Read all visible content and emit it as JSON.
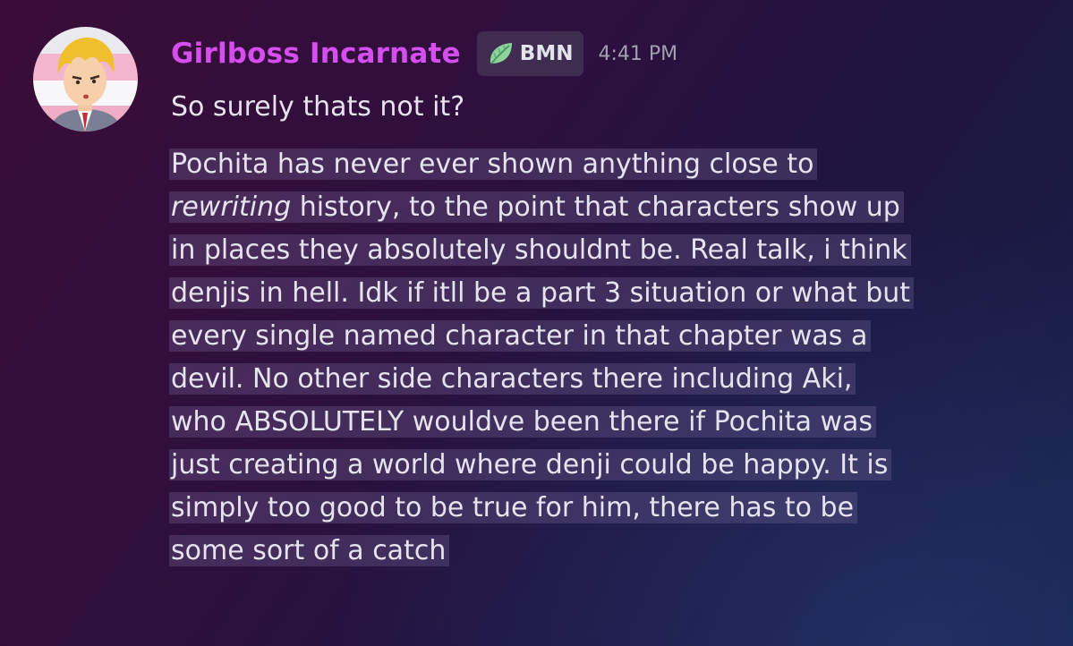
{
  "message": {
    "author": "Girlboss Incarnate",
    "role_tag": {
      "icon": "leaf-icon",
      "label": "BMN"
    },
    "timestamp": "4:41 PM",
    "first_line": "So surely thats not it?",
    "quote": {
      "l1": "Pochita has never ever shown anything close to",
      "l2_em": "rewriting",
      "l2_rest": " history, to the point that characters show up",
      "l3": "in places they absolutely shouldnt be. Real talk, i think",
      "l4": "denjis in hell. Idk if itll be a part 3 situation or what but",
      "l5": "every single named character in that chapter was a",
      "l6": "devil. No other side characters there including Aki,",
      "l7": "who ABSOLUTELY wouldve been there if Pochita was",
      "l8": "just creating a world where denji could be happy. It is",
      "l9": "simply too good to be true for him, there has to be",
      "l10": "some sort of a catch"
    }
  },
  "colors": {
    "username": "#d64df0",
    "timestamp": "#a39eb2",
    "text": "#e6e2ee",
    "highlight": "#73649a"
  }
}
